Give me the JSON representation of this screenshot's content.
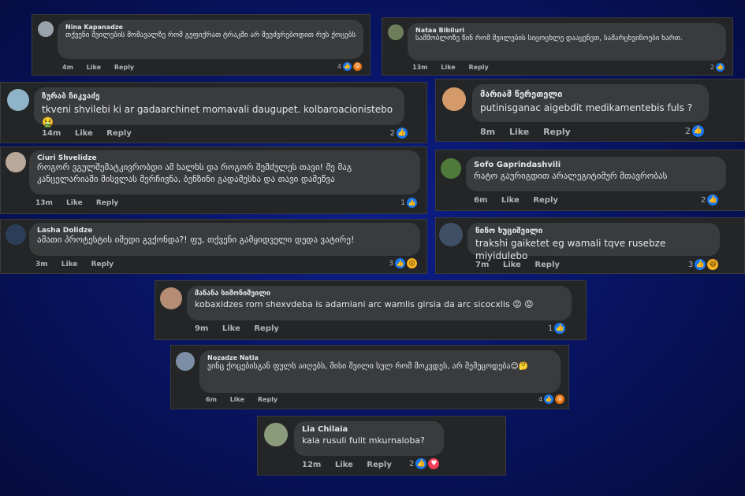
{
  "comments": [
    {
      "name": "Nina Kapanadze",
      "text": "თქვენი შვილების მომავალზე რომ გეფიქრათ ტრაკში არ შეუძვრებოდით რუს ქოცებს",
      "time": "4m",
      "like": "Like",
      "reply": "Reply",
      "count": "4",
      "reactions": [
        "like-icon",
        "angry-icon"
      ]
    },
    {
      "name": "Nataa Bibiluri",
      "text": "სამშობლოზე წინ რომ შვილების სიცოცხლე დააყენეთ, სამარცხვინოები ხართ.",
      "time": "13m",
      "like": "Like",
      "reply": "Reply",
      "count": "2",
      "reactions": [
        "like-icon"
      ]
    },
    {
      "name": "ზურაბ ჩიკვაძე",
      "text": "tkveni shvilebi ki ar gadaarchinet momavali daugupet. kolbaroacionistebo 🤮",
      "time": "14m",
      "like": "Like",
      "reply": "Reply",
      "count": "2",
      "reactions": [
        "like-icon"
      ]
    },
    {
      "name": "მარიამ წერეთელი",
      "text": "putinisganac aigebdit medikamentebis fuls ?",
      "time": "8m",
      "like": "Like",
      "reply": "Reply",
      "count": "2",
      "reactions": [
        "like-icon"
      ]
    },
    {
      "name": "Ciuri Shvelidze",
      "text": "როგორ ვგულშემატკივრობდი ამ ხალხს და როგორ შემძულეს თავი! მე მაგ კანცელარიაში მისვლას მერჩივნა, ბენზინი გადამესხა და თავი დამეწვა",
      "time": "13m",
      "like": "Like",
      "reply": "Reply",
      "count": "1",
      "reactions": [
        "like-icon"
      ]
    },
    {
      "name": "Sofo Gaprindashvili",
      "text": "რატო გაურიგდით არალეგიტიმურ მთავრობას",
      "time": "6m",
      "like": "Like",
      "reply": "Reply",
      "count": "2",
      "reactions": [
        "like-icon"
      ]
    },
    {
      "name": "Lasha Dolidze",
      "text": "ამათი პროტესტის იმედი გვქონდა?! ფუ, თქვენი გამყიდველი დედა ვატირე!",
      "time": "3m",
      "like": "Like",
      "reply": "Reply",
      "count": "3",
      "reactions": [
        "like-icon",
        "wow-icon"
      ]
    },
    {
      "name": "ნინო ხუციშვილი",
      "text": "trakshi gaiketet eg wamali tqve rusebze miyidulebo",
      "time": "7m",
      "like": "Like",
      "reply": "Reply",
      "count": "3",
      "reactions": [
        "like-icon",
        "haha-icon"
      ]
    },
    {
      "name": "მანანა სიმონიშვილი",
      "text": "kobaxidzes rom shexvdeba is adamiani arc wamlis girsia da arc sicocxlis 😡 😡",
      "time": "9m",
      "like": "Like",
      "reply": "Reply",
      "count": "1",
      "reactions": [
        "like-icon"
      ]
    },
    {
      "name": "Nozadze Natia",
      "text": "ვინც ქოცებისგან ფულს აიღებს, მისი შვილი სულ რომ მოკვდეს, არ შემეცოდება😊🤔",
      "time": "6m",
      "like": "Like",
      "reply": "Reply",
      "count": "4",
      "reactions": [
        "like-icon",
        "angry-icon"
      ]
    },
    {
      "name": "Lia Chilaia",
      "text": "kaia rusuli fulit mkurnaloba?",
      "time": "12m",
      "like": "Like",
      "reply": "Reply",
      "count": "2",
      "reactions": [
        "like-icon",
        "love-icon"
      ]
    }
  ],
  "icons": {
    "like": "👍",
    "angry": "😡",
    "haha": "😆",
    "love": "♥",
    "wow": "😮"
  },
  "colors": {
    "background": "#081565",
    "card": "#242526",
    "bubble": "#3a3b3c",
    "like": "#1877f2"
  }
}
